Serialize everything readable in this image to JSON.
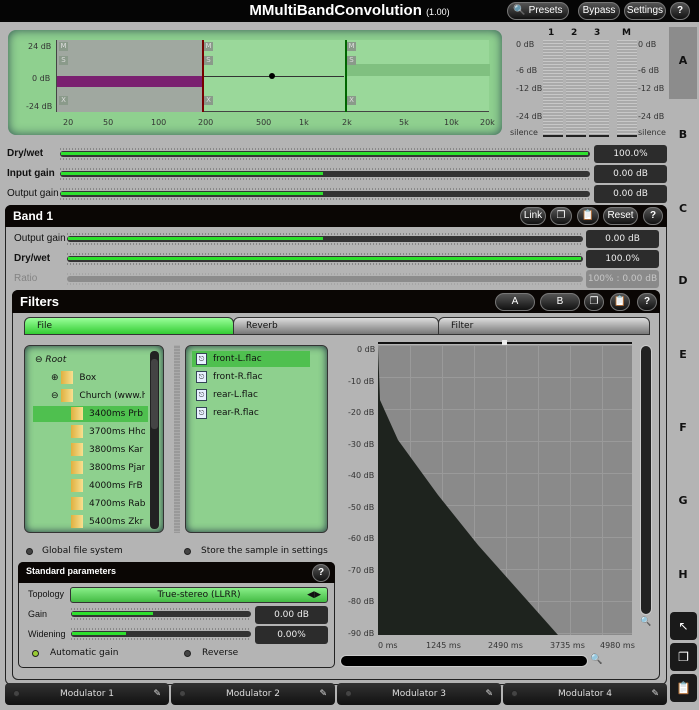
{
  "header": {
    "title": "MMultiBandConvolution",
    "version": "(1.00)",
    "presets": "Presets",
    "bypass": "Bypass",
    "settings": "Settings",
    "help": "?"
  },
  "eq": {
    "ylabels": [
      "24 dB",
      "0 dB",
      "-24 dB"
    ],
    "xlabels": [
      "20",
      "50",
      "100",
      "200",
      "500",
      "1k",
      "2k",
      "5k",
      "10k",
      "20k"
    ],
    "band_buttons": [
      "M",
      "S",
      "X"
    ],
    "crossovers_hz": [
      200,
      2000
    ]
  },
  "meters": {
    "channels": [
      "1",
      "2",
      "3",
      "M"
    ],
    "left_labels": [
      "0 dB",
      "-6 dB",
      "-12 dB",
      "-24 dB",
      "silence"
    ],
    "right_labels": [
      "0 dB",
      "-6 dB",
      "-12 dB",
      "-24 dB",
      "silence"
    ]
  },
  "side_letters": [
    "A",
    "B",
    "C",
    "D",
    "E",
    "F",
    "G",
    "H"
  ],
  "global": [
    {
      "label": "Dry/wet",
      "value": "100.0%",
      "fill": 1.0
    },
    {
      "label": "Input gain",
      "value": "0.00 dB",
      "fill": 0.5
    },
    {
      "label": "Output gain",
      "value": "0.00 dB",
      "fill": 0.5
    }
  ],
  "band": {
    "title": "Band 1",
    "link": "Link",
    "reset": "Reset",
    "help": "?",
    "rows": [
      {
        "label": "Output gain",
        "value": "0.00 dB",
        "fill": 0.5
      },
      {
        "label": "Dry/wet",
        "value": "100.0%",
        "fill": 1.0
      },
      {
        "label": "Ratio",
        "value": "100% : 0.00 dB",
        "fill": 0
      }
    ]
  },
  "filters": {
    "title": "Filters",
    "a": "A",
    "b": "B",
    "help": "?",
    "tabs": [
      "File",
      "Reverb",
      "Filter"
    ],
    "tree": [
      {
        "label": "Root",
        "level": 0
      },
      {
        "label": "Box",
        "level": 1
      },
      {
        "label": "Church (www.h",
        "level": 1
      },
      {
        "label": "3400ms Prb",
        "level": 2,
        "selected": true
      },
      {
        "label": "3700ms Hho",
        "level": 2
      },
      {
        "label": "3800ms Kar",
        "level": 2
      },
      {
        "label": "3800ms Pjar",
        "level": 2
      },
      {
        "label": "4000ms FrB",
        "level": 2
      },
      {
        "label": "4700ms Rab",
        "level": 2
      },
      {
        "label": "5400ms Zkr",
        "level": 2
      }
    ],
    "files": [
      "front-L.flac",
      "front-R.flac",
      "rear-L.flac",
      "rear-R.flac"
    ],
    "global_fs": "Global file system",
    "store_sample": "Store the sample in settings",
    "std": {
      "title": "Standard parameters",
      "help": "?",
      "topology_label": "Topology",
      "topology": "True-stereo (LLRR)",
      "gain_label": "Gain",
      "gain": "0.00 dB",
      "gain_fill": 0.5,
      "widening_label": "Widening",
      "widening": "0.00%",
      "widening_fill": 0.3,
      "auto_gain": "Automatic gain",
      "reverse": "Reverse"
    },
    "chart": {
      "ylabels": [
        "0 dB",
        "-10 dB",
        "-20 dB",
        "-30 dB",
        "-40 dB",
        "-50 dB",
        "-60 dB",
        "-70 dB",
        "-80 dB",
        "-90 dB"
      ],
      "xlabels": [
        "0 ms",
        "1245 ms",
        "2490 ms",
        "3735 ms",
        "4980 ms"
      ]
    }
  },
  "modulators": [
    "Modulator 1",
    "Modulator 2",
    "Modulator 3",
    "Modulator 4"
  ],
  "colors": {
    "accent": "#2ee02e",
    "panel_green": "#8ed08e",
    "band1": "#7a2070"
  }
}
